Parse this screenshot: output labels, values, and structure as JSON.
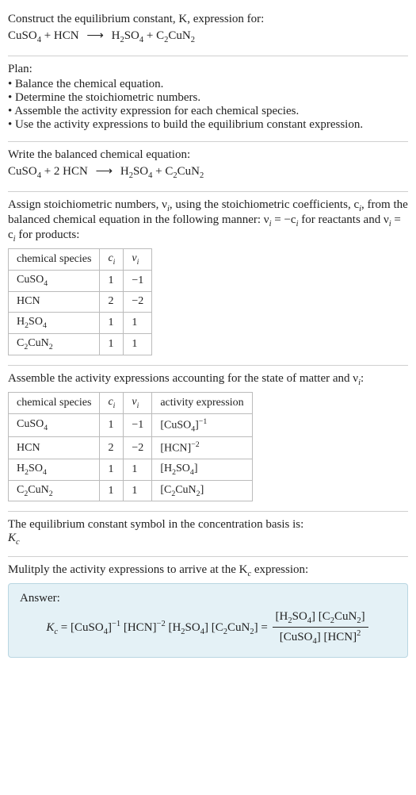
{
  "title_line1": "Construct the equilibrium constant, K, expression for:",
  "eq_unbalanced": {
    "r1": "CuSO",
    "r1s": "4",
    "plus1": " + ",
    "r2": "HCN",
    "arrow": "⟶",
    "p1": "H",
    "p1s1": "2",
    "p1m": "SO",
    "p1s2": "4",
    "plus2": " + ",
    "p2a": "C",
    "p2s1": "2",
    "p2b": "CuN",
    "p2s2": "2"
  },
  "plan_label": "Plan:",
  "plan_items": [
    "Balance the chemical equation.",
    "Determine the stoichiometric numbers.",
    "Assemble the activity expression for each chemical species.",
    "Use the activity expressions to build the equilibrium constant expression."
  ],
  "balanced_label": "Write the balanced chemical equation:",
  "eq_balanced": {
    "r1": "CuSO",
    "r1s": "4",
    "plus1": " + 2 ",
    "r2": "HCN",
    "arrow": "⟶",
    "p1": "H",
    "p1s1": "2",
    "p1m": "SO",
    "p1s2": "4",
    "plus2": " + ",
    "p2a": "C",
    "p2s1": "2",
    "p2b": "CuN",
    "p2s2": "2"
  },
  "stoich_intro1": "Assign stoichiometric numbers, ν",
  "stoich_intro_i1": "i",
  "stoich_intro2": ", using the stoichiometric coefficients, c",
  "stoich_intro_i2": "i",
  "stoich_intro3": ", from the balanced chemical equation in the following manner: ν",
  "stoich_intro_i3": "i",
  "stoich_intro4": " = −c",
  "stoich_intro_i4": "i",
  "stoich_intro5": " for reactants and ν",
  "stoich_intro_i5": "i",
  "stoich_intro6": " = c",
  "stoich_intro_i6": "i",
  "stoich_intro7": " for products:",
  "stoich_headers": {
    "h1": "chemical species",
    "h2": "c",
    "h2i": "i",
    "h3": "ν",
    "h3i": "i"
  },
  "stoich_rows": [
    {
      "name_a": "CuSO",
      "name_s1": "4",
      "name_b": "",
      "name_s2": "",
      "c": "1",
      "v": "−1"
    },
    {
      "name_a": "HCN",
      "name_s1": "",
      "name_b": "",
      "name_s2": "",
      "c": "2",
      "v": "−2"
    },
    {
      "name_a": "H",
      "name_s1": "2",
      "name_b": "SO",
      "name_s2": "4",
      "c": "1",
      "v": "1"
    },
    {
      "name_a": "C",
      "name_s1": "2",
      "name_b": "CuN",
      "name_s2": "2",
      "c": "1",
      "v": "1"
    }
  ],
  "activity_intro1": "Assemble the activity expressions accounting for the state of matter and ν",
  "activity_intro_i": "i",
  "activity_intro2": ":",
  "activity_headers": {
    "h1": "chemical species",
    "h2": "c",
    "h2i": "i",
    "h3": "ν",
    "h3i": "i",
    "h4": "activity expression"
  },
  "activity_rows": [
    {
      "name_a": "CuSO",
      "name_s1": "4",
      "name_b": "",
      "name_s2": "",
      "c": "1",
      "v": "−1",
      "ae_pre": "[CuSO",
      "ae_s1": "4",
      "ae_mid": "]",
      "ae_exp": "−1",
      "ae_post": ""
    },
    {
      "name_a": "HCN",
      "name_s1": "",
      "name_b": "",
      "name_s2": "",
      "c": "2",
      "v": "−2",
      "ae_pre": "[HCN]",
      "ae_s1": "",
      "ae_mid": "",
      "ae_exp": "−2",
      "ae_post": ""
    },
    {
      "name_a": "H",
      "name_s1": "2",
      "name_b": "SO",
      "name_s2": "4",
      "c": "1",
      "v": "1",
      "ae_pre": "[H",
      "ae_s1": "2",
      "ae_mid": "SO",
      "ae_exp": "",
      "ae_post": "",
      "ae_s2": "4",
      "ae_close": "]"
    },
    {
      "name_a": "C",
      "name_s1": "2",
      "name_b": "CuN",
      "name_s2": "2",
      "c": "1",
      "v": "1",
      "ae_pre": "[C",
      "ae_s1": "2",
      "ae_mid": "CuN",
      "ae_exp": "",
      "ae_post": "",
      "ae_s2": "2",
      "ae_close": "]"
    }
  ],
  "kc_symbol_intro": "The equilibrium constant symbol in the concentration basis is:",
  "kc_symbol": "K",
  "kc_symbol_sub": "c",
  "multiply_intro1": "Mulitply the activity expressions to arrive at the K",
  "multiply_intro_sub": "c",
  "multiply_intro2": " expression:",
  "answer_label": "Answer:",
  "answer": {
    "lhs_K": "K",
    "lhs_c": "c",
    "eq": " = ",
    "t1": "[CuSO",
    "t1s": "4",
    "t1c": "]",
    "t1e": "−1",
    "t2": " [HCN]",
    "t2e": "−2",
    "t3": " [H",
    "t3s1": "2",
    "t3m": "SO",
    "t3s2": "4",
    "t3c": "]",
    "t4": " [C",
    "t4s1": "2",
    "t4m": "CuN",
    "t4s2": "2",
    "t4c": "]",
    "eq2": " = ",
    "num1": "[H",
    "num1s1": "2",
    "num1m": "SO",
    "num1s2": "4",
    "num1c": "]",
    "num2": " [C",
    "num2s1": "2",
    "num2m": "CuN",
    "num2s2": "2",
    "num2c": "]",
    "den1": "[CuSO",
    "den1s": "4",
    "den1c": "]",
    "den2": " [HCN]",
    "den2e": "2"
  }
}
